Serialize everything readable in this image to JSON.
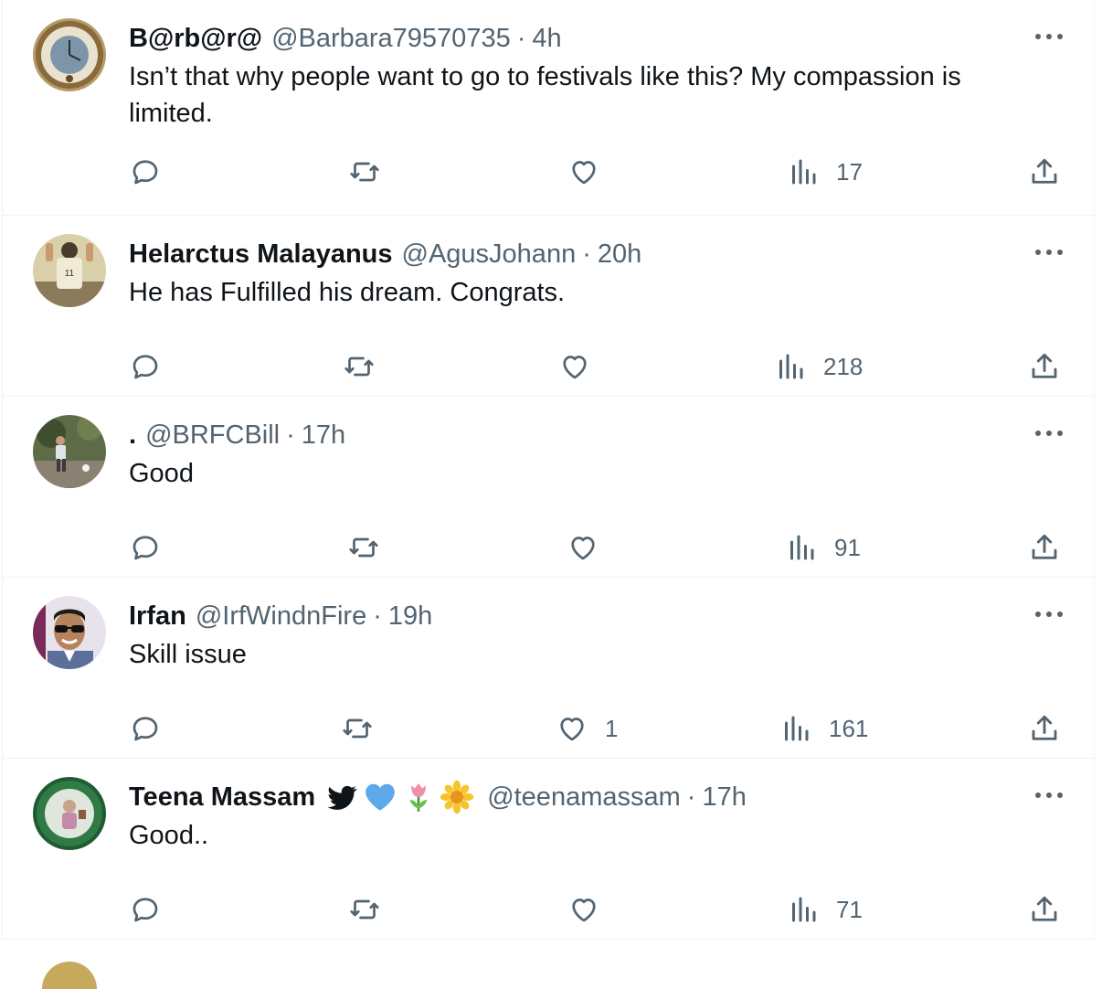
{
  "tweets": [
    {
      "name": "B@rb@r@",
      "handle": "@Barbara79570735",
      "separator": "·",
      "time": "4h",
      "text": "Isn’t that why people want to go to festivals like this? My compassion is limited.",
      "reply_count": "",
      "retweet_count": "",
      "like_count": "",
      "views": "17",
      "avatar": "clock-avatar"
    },
    {
      "name": "Helarctus Malayanus",
      "handle": "@AgusJohann",
      "separator": "·",
      "time": "20h",
      "text": "He has Fulfilled his dream. Congrats.",
      "reply_count": "",
      "retweet_count": "",
      "like_count": "",
      "views": "218",
      "avatar": "jersey-player-avatar"
    },
    {
      "name": ".",
      "handle": "@BRFCBill",
      "separator": "·",
      "time": "17h",
      "text": "Good",
      "reply_count": "",
      "retweet_count": "",
      "like_count": "",
      "views": "91",
      "avatar": "hiker-avatar"
    },
    {
      "name": "Irfan",
      "handle": "@IrfWindnFire",
      "separator": "·",
      "time": "19h",
      "text": "Skill issue",
      "reply_count": "",
      "retweet_count": "",
      "like_count": "1",
      "views": "161",
      "avatar": "sunglasses-man-avatar"
    },
    {
      "name": "Teena Massam",
      "handle": "@teenamassam",
      "separator": "·",
      "time": "17h",
      "text": "Good..",
      "reply_count": "",
      "retweet_count": "",
      "like_count": "",
      "views": "71",
      "avatar": "green-frame-avatar",
      "badges": [
        "twitter-bird-icon",
        "blue-heart-icon",
        "tulip-icon",
        "blossom-icon"
      ]
    }
  ],
  "colors": {
    "text_primary": "#0f1419",
    "text_secondary": "#536471",
    "border": "#eff3f4"
  }
}
